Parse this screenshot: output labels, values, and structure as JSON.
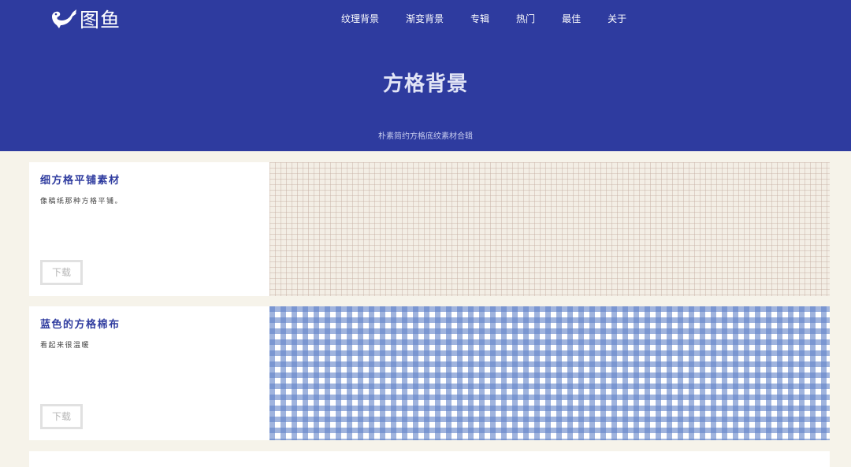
{
  "brand": {
    "name": "图鱼"
  },
  "nav": {
    "items": [
      "纹理背景",
      "渐变背景",
      "专辑",
      "热门",
      "最佳",
      "关于"
    ]
  },
  "hero": {
    "title": "方格背景",
    "subtitle": "朴素简约方格底纹素材合辑"
  },
  "cards": [
    {
      "title": "细方格平铺素材",
      "desc": "像稿纸那种方格平铺。",
      "button": "下载"
    },
    {
      "title": "蓝色的方格棉布",
      "desc": "看起来很温暖",
      "button": "下载"
    }
  ],
  "colors": {
    "header_bg": "#2e3b9f",
    "page_bg": "#f6f3ea",
    "title_blue": "#2e3b9f",
    "grid_paper_bg": "#f3eee5",
    "gingham_blue": "#6182c8"
  },
  "icons": {
    "logo": "whale-logo-icon"
  }
}
